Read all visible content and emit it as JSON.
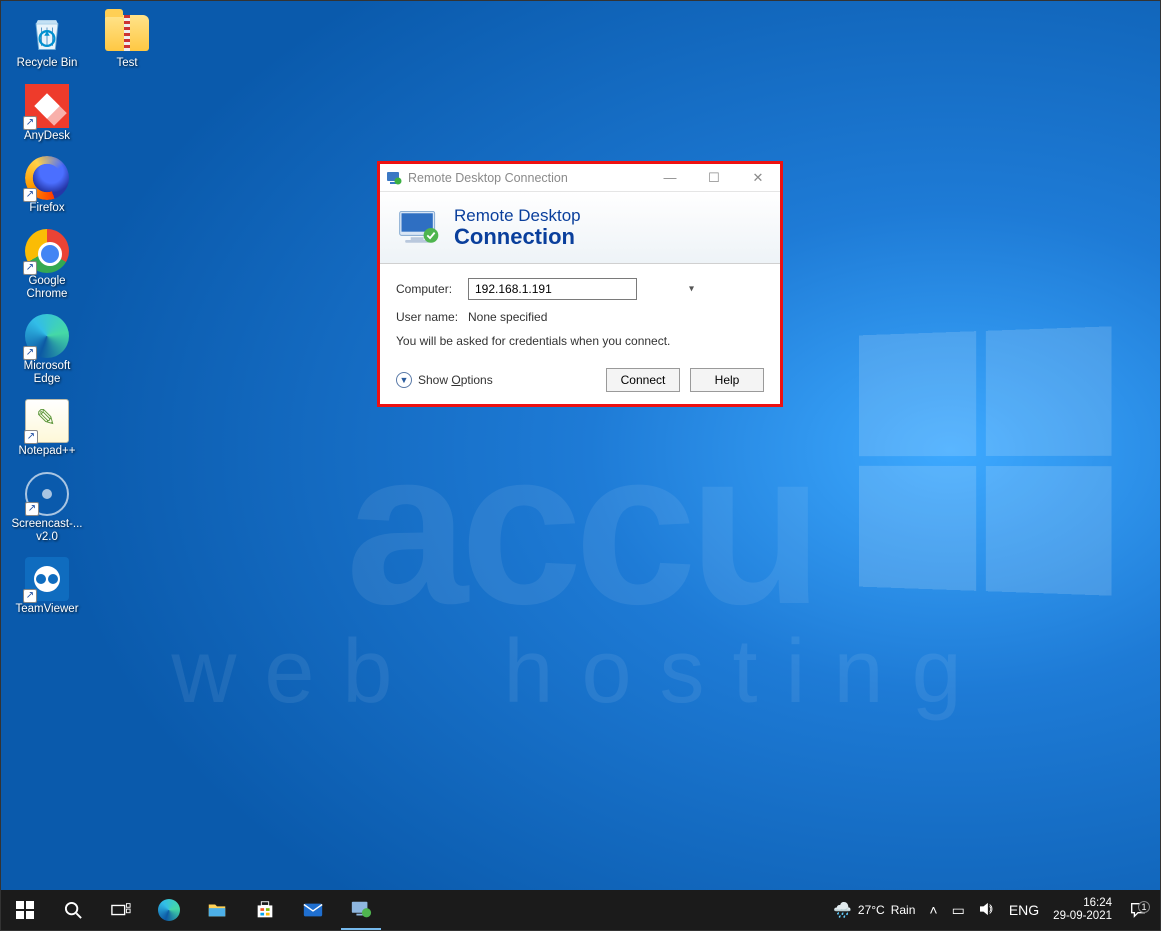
{
  "desktop_icons_col1": [
    {
      "id": "recycle-bin",
      "label": "Recycle Bin",
      "shortcut": false
    },
    {
      "id": "anydesk",
      "label": "AnyDesk",
      "shortcut": true
    },
    {
      "id": "firefox",
      "label": "Firefox",
      "shortcut": true
    },
    {
      "id": "chrome",
      "label": "Google Chrome",
      "shortcut": true
    },
    {
      "id": "edge",
      "label": "Microsoft Edge",
      "shortcut": true
    },
    {
      "id": "npp",
      "label": "Notepad++",
      "shortcut": true
    },
    {
      "id": "scast",
      "label": "Screencast-... v2.0",
      "shortcut": true
    },
    {
      "id": "tv",
      "label": "TeamViewer",
      "shortcut": true
    }
  ],
  "desktop_icons_col2": [
    {
      "id": "test-folder",
      "label": "Test",
      "shortcut": false
    }
  ],
  "rdc": {
    "window_title": "Remote Desktop Connection",
    "banner_line1": "Remote Desktop",
    "banner_line2": "Connection",
    "label_computer": "Computer:",
    "label_username": "User name:",
    "value_computer": "192.168.1.191",
    "value_username": "None specified",
    "hint": "You will be asked for credentials when you connect.",
    "show_options_prefix": "Show ",
    "show_options_underline": "O",
    "show_options_suffix": "ptions",
    "btn_connect": "Connect",
    "btn_help": "Help"
  },
  "taskbar": {
    "weather_temp": "27°C",
    "weather_cond": "Rain",
    "lang": "ENG",
    "time": "16:24",
    "date": "29-09-2021",
    "notif_count": "1"
  },
  "watermark": {
    "line1": "accu",
    "line2": "web hosting"
  }
}
